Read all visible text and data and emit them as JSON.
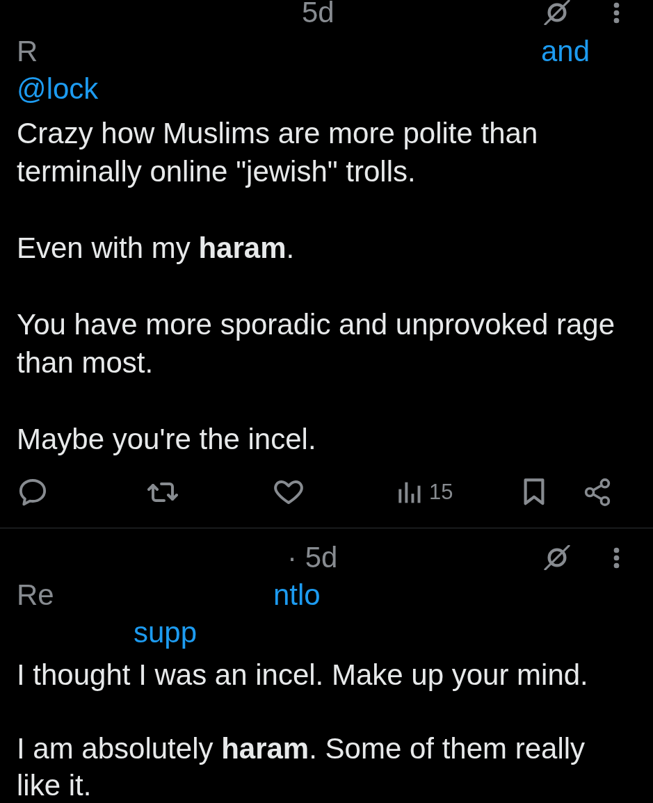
{
  "posts": [
    {
      "time": "5d",
      "replying_to": [
        [
          {
            "text": "R",
            "kind": "muted"
          },
          {
            "text": "and",
            "kind": "link"
          }
        ],
        [
          {
            "text": "@lock",
            "kind": "link"
          }
        ]
      ],
      "body": [
        "Crazy how Muslims are more polite than\nterminally online \"jewish\" trolls.",
        "Even with my **haram**.",
        "You have more sporadic and unprovoked rage\nthan most.",
        "Maybe you're the incel."
      ],
      "actions": {
        "views": "15"
      }
    },
    {
      "time": "· 5d",
      "replying_to": [
        [
          {
            "text": "Re",
            "kind": "muted"
          },
          {
            "text": "ntlo",
            "kind": "link"
          }
        ],
        [
          {
            "text": "supp",
            "kind": "link"
          }
        ]
      ],
      "body": [
        "I thought I was an incel. Make up your mind.",
        "I am absolutely **haram**. Some of them really\nlike it."
      ]
    }
  ]
}
